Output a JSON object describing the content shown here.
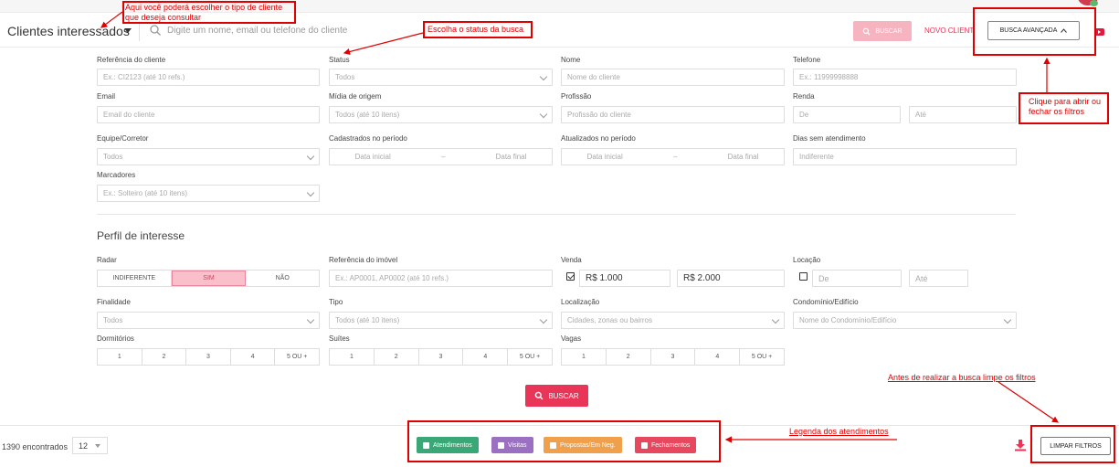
{
  "header": {
    "title": "Clientes interessados",
    "search_placeholder": "Digite um nome, email ou telefone do cliente",
    "buscar": "BUSCAR",
    "novo": "NOVO CLIENTE",
    "busca_avancada": "BUSCA AVANÇADA"
  },
  "filters": {
    "referencia": {
      "label": "Referência do cliente",
      "placeholder": "Ex.: CI2123 (até 10 refs.)"
    },
    "status": {
      "label": "Status",
      "value": "Todos"
    },
    "nome": {
      "label": "Nome",
      "placeholder": "Nome do cliente"
    },
    "telefone": {
      "label": "Telefone",
      "placeholder": "Ex.: 11999998888"
    },
    "email": {
      "label": "Email",
      "placeholder": "Email do cliente"
    },
    "midia": {
      "label": "Mídia de origem",
      "value": "Todos (até 10 itens)"
    },
    "profissao": {
      "label": "Profissão",
      "placeholder": "Profissão do cliente"
    },
    "renda": {
      "label": "Renda",
      "de": "De",
      "ate": "Até"
    },
    "equipe": {
      "label": "Equipe/Corretor",
      "value": "Todos"
    },
    "cadastrados": {
      "label": "Cadastrados no período",
      "inicial": "Data inicial",
      "dash": "–",
      "final": "Data final"
    },
    "atualizados": {
      "label": "Atualizados no período",
      "inicial": "Data inicial",
      "dash": "–",
      "final": "Data final"
    },
    "dias": {
      "label": "Dias sem atendimento",
      "placeholder": "Indiferente"
    },
    "marcadores": {
      "label": "Marcadores",
      "placeholder": "Ex.: Solteiro (até 10 itens)"
    }
  },
  "perfil": {
    "title": "Perfil de interesse",
    "radar": {
      "label": "Radar",
      "options": [
        "INDIFERENTE",
        "SIM",
        "NÃO"
      ],
      "selected": "SIM"
    },
    "ref_imovel": {
      "label": "Referência do imóvel",
      "placeholder": "Ex.: AP0001, AP0002 (até 10 refs.)"
    },
    "venda": {
      "label": "Venda",
      "checked": true,
      "min": "R$ 1.000",
      "max": "R$ 2.000"
    },
    "locacao": {
      "label": "Locação",
      "checked": false,
      "de": "De",
      "ate": "Até"
    },
    "finalidade": {
      "label": "Finalidade",
      "value": "Todos"
    },
    "tipo": {
      "label": "Tipo",
      "value": "Todos (até 10 itens)"
    },
    "localizacao": {
      "label": "Localização",
      "placeholder": "Cidades, zonas ou bairros"
    },
    "condominio": {
      "label": "Condomínio/Edifício",
      "placeholder": "Nome do Condomínio/Edifício"
    },
    "dormitorios": {
      "label": "Dormitórios",
      "options": [
        "1",
        "2",
        "3",
        "4",
        "5 OU +"
      ]
    },
    "suites": {
      "label": "Suítes",
      "options": [
        "1",
        "2",
        "3",
        "4",
        "5 OU +"
      ]
    },
    "vagas": {
      "label": "Vagas",
      "options": [
        "1",
        "2",
        "3",
        "4",
        "5 OU +"
      ]
    },
    "buscar": "BUSCAR"
  },
  "footer": {
    "count": "1390 encontrados",
    "per_page": "12",
    "legend": [
      {
        "label": "Atendimentos",
        "color": "#3aa876"
      },
      {
        "label": "Visitas",
        "color": "#9b6fc1"
      },
      {
        "label": "Propostas/Em Neg.",
        "color": "#f0a04b"
      },
      {
        "label": "Fechamentos",
        "color": "#e8485e"
      }
    ],
    "limpar": "LIMPAR FILTROS"
  },
  "annotations": {
    "tipo_cliente": "Aqui você poderá escolher o tipo de cliente que deseja consultar",
    "status": "Escolha o status da busca",
    "abrir_fechar": "Clique para abrir ou fechar os filtros",
    "limpe": "Antes de realizar a busca limpe os filtros",
    "legenda": "Legenda dos atendimentos"
  },
  "colors": {
    "accent": "#e83558",
    "annotation": "#e00000"
  }
}
